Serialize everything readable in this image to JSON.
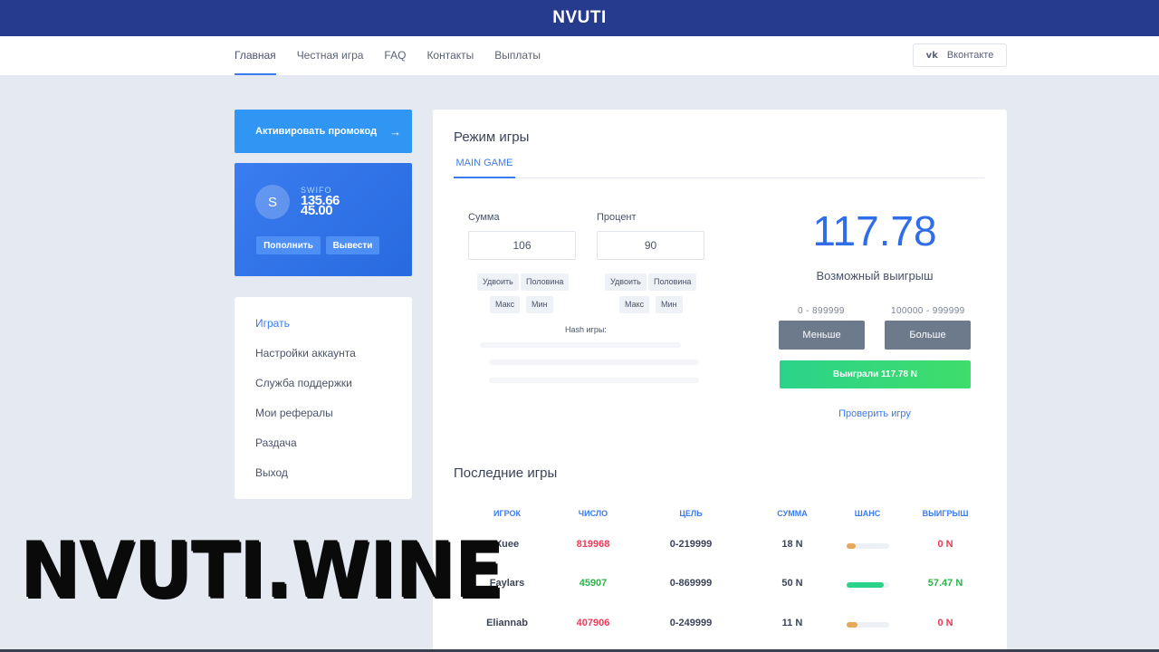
{
  "header": {
    "brand": "NVUTI"
  },
  "nav": {
    "links": [
      "Главная",
      "Честная игра",
      "FAQ",
      "Контакты",
      "Выплаты"
    ],
    "vk_label": "Вконтакте"
  },
  "sidebar": {
    "promo_label": "Активировать промокод",
    "user": {
      "avatar_letter": "S",
      "name": "SWIFO",
      "balance_line1": "135.66",
      "balance_line2": "45.00"
    },
    "deposit_label": "Пополнить",
    "withdraw_label": "Вывести",
    "menu": [
      "Играть",
      "Настройки аккаунта",
      "Служба поддержки",
      "Мои рефералы",
      "Раздача",
      "Выход"
    ]
  },
  "game": {
    "title": "Режим игры",
    "tab": "MAIN GAME",
    "amount_label": "Сумма",
    "amount_value": "106",
    "percent_label": "Процент",
    "percent_value": "90",
    "btn_double": "Удвоить",
    "btn_half": "Половина",
    "btn_max": "Макс",
    "btn_min": "Мин",
    "hash_label": "Hash игры:",
    "possible_win_value": "117.78",
    "possible_win_label": "Возможный выигрыш",
    "range_low": "0 - 899999",
    "range_high": "100000 - 999999",
    "btn_less": "Меньше",
    "btn_more": "Больше",
    "win_message": "Выиграли 117.78 N",
    "verify_label": "Проверить игру"
  },
  "history": {
    "title": "Последние игры",
    "columns": [
      "ИГРОК",
      "ЧИСЛО",
      "ЦЕЛЬ",
      "СУММА",
      "ШАНС",
      "ВЫИГРЫШ"
    ],
    "rows": [
      {
        "player": "Xuee",
        "number": "819968",
        "target": "0-219999",
        "sum": "18 N",
        "chance": 0.22,
        "win": "0 N",
        "result": "lose"
      },
      {
        "player": "Faylars",
        "number": "45907",
        "target": "0-869999",
        "sum": "50 N",
        "chance": 0.87,
        "win": "57.47 N",
        "result": "win"
      },
      {
        "player": "Eliannab",
        "number": "407906",
        "target": "0-249999",
        "sum": "11 N",
        "chance": 0.25,
        "win": "0 N",
        "result": "lose"
      }
    ]
  },
  "watermark": "NVUTI.WINE",
  "colors": {
    "accent": "#3b7bf0",
    "topbar": "#273b8e",
    "win": "#2bd38a",
    "lose": "#ee3b5a",
    "low_chance": "#e8a85a"
  }
}
